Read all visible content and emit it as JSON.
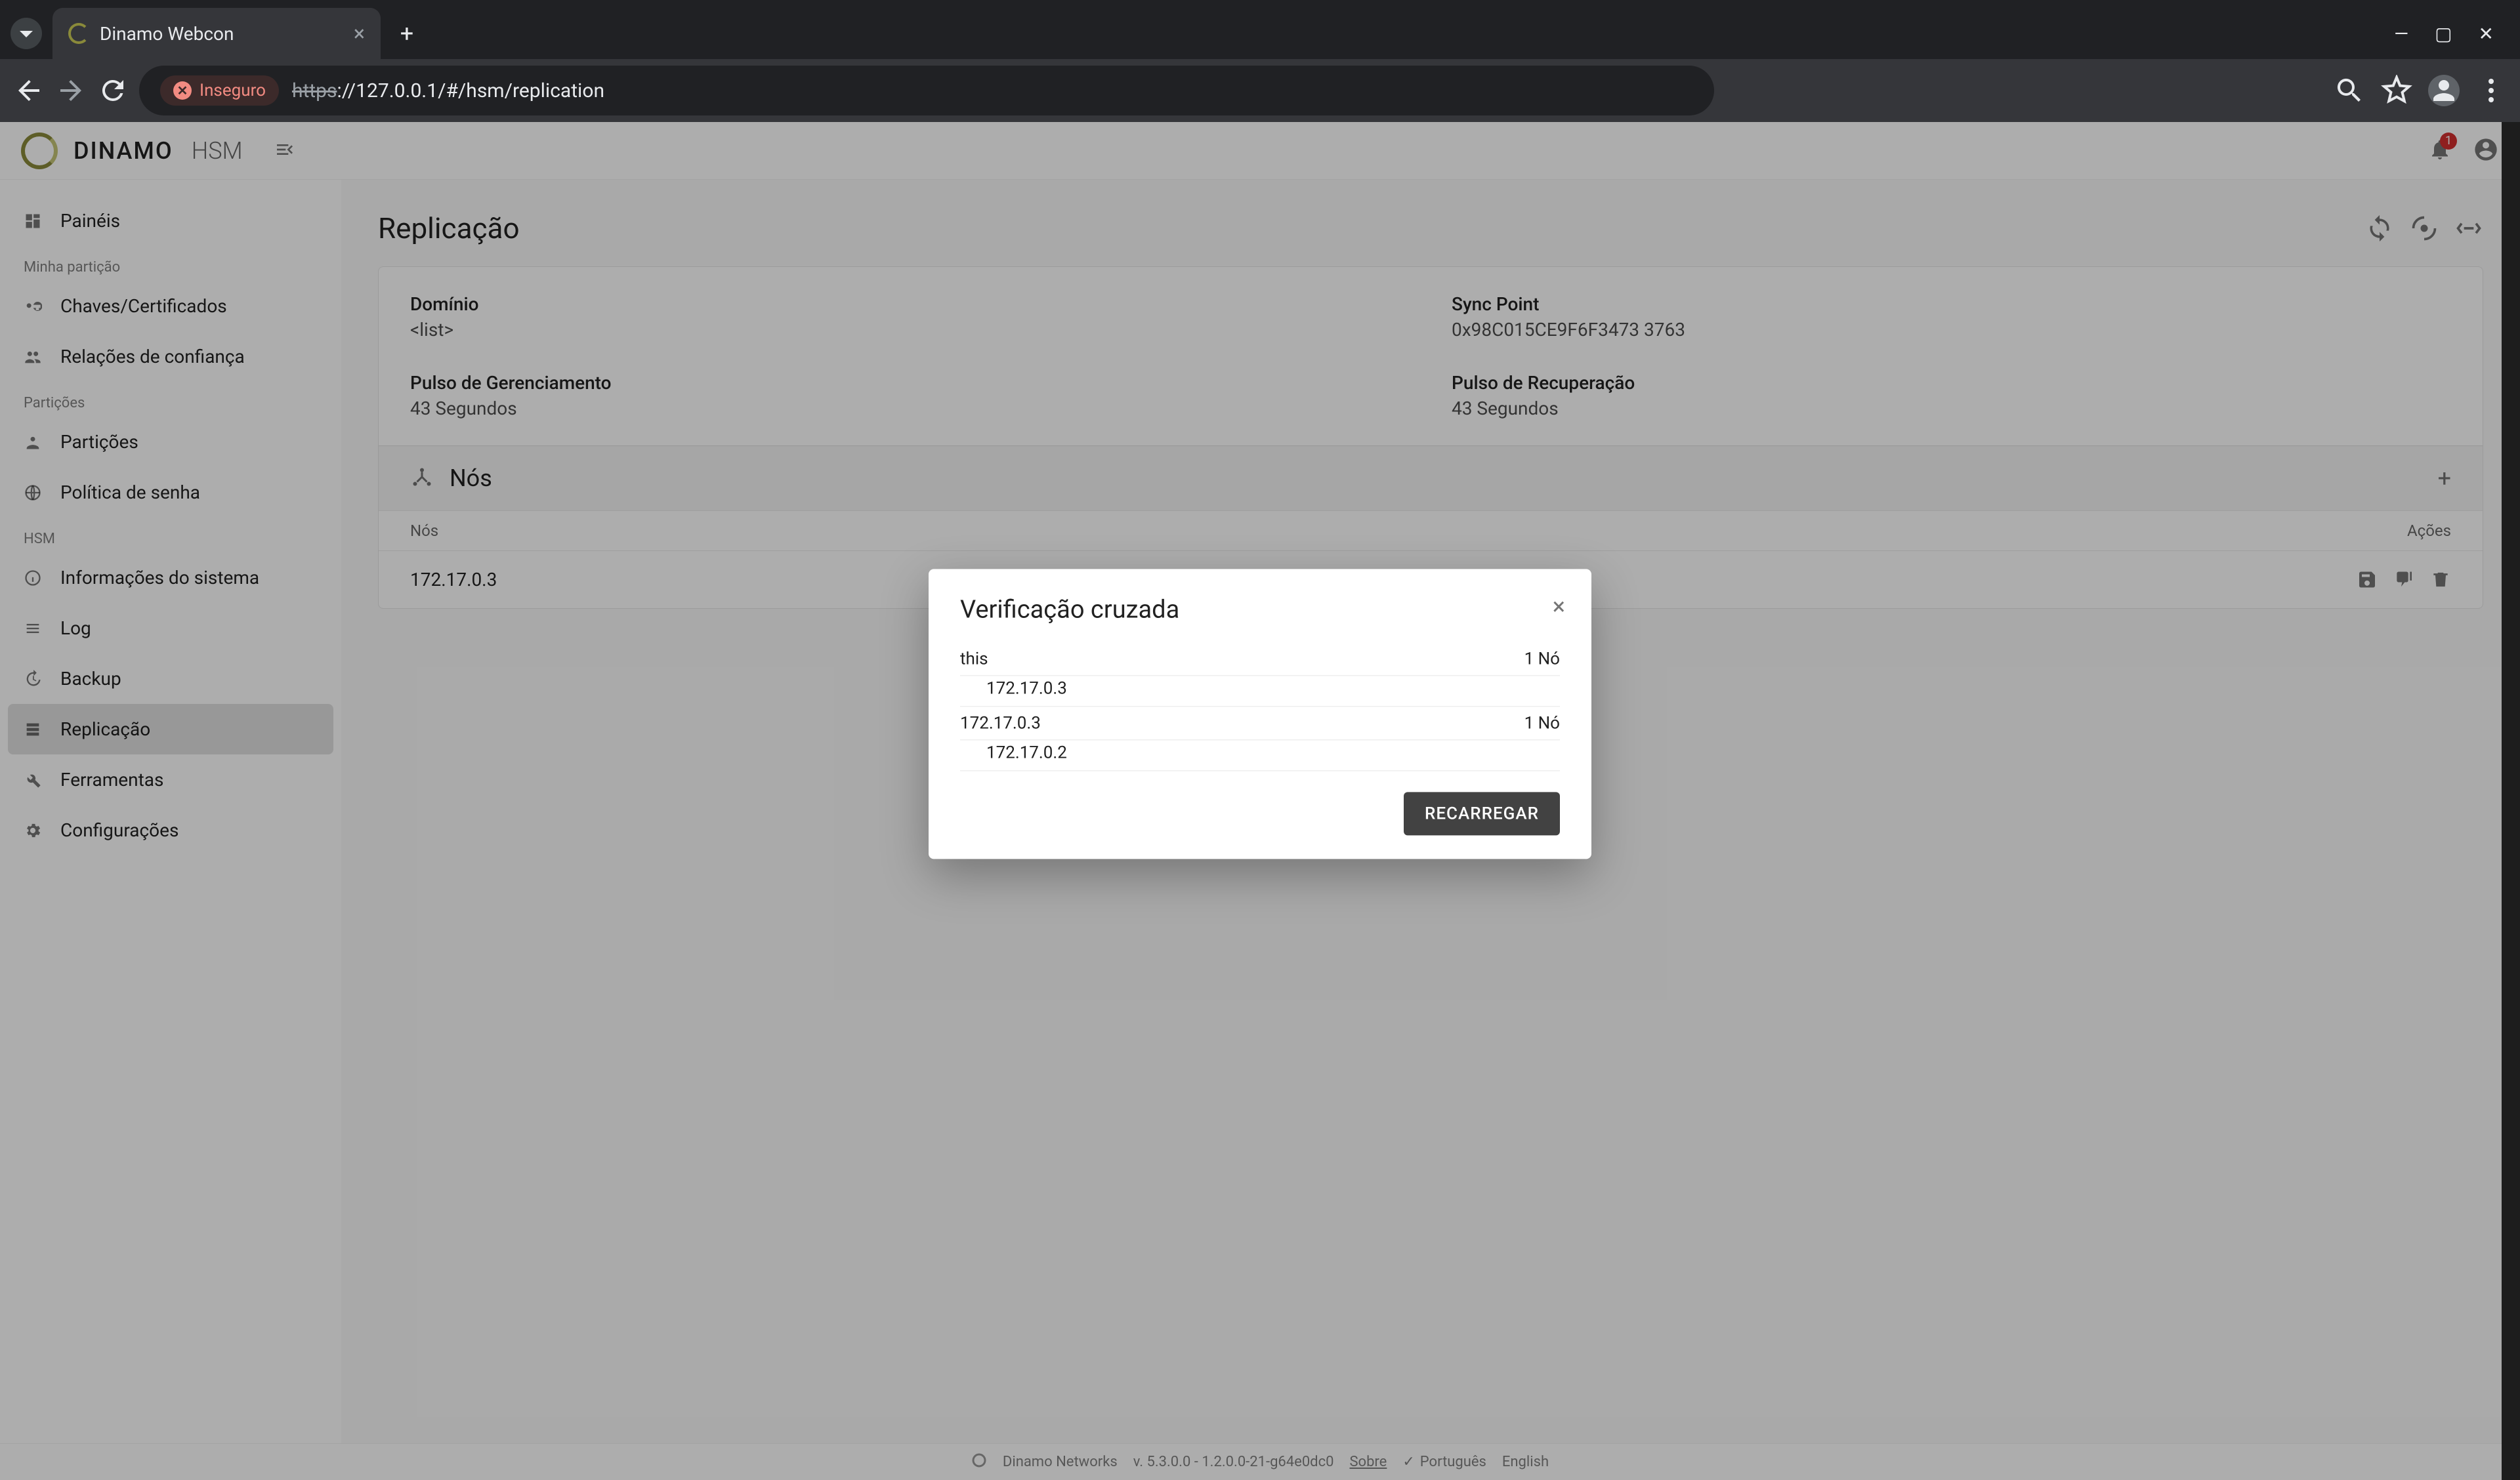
{
  "browser": {
    "tab_title": "Dinamo Webcon",
    "insecure_label": "Inseguro",
    "url_protocol": "https",
    "url_rest": "://127.0.0.1/#/hsm/replication"
  },
  "header": {
    "brand": "DINAMO",
    "brand_sub": "HSM",
    "notif_count": "1"
  },
  "sidebar": {
    "items": [
      {
        "label": "Painéis",
        "icon": "dashboard"
      },
      {
        "section": "Minha partição"
      },
      {
        "label": "Chaves/Certificados",
        "icon": "key"
      },
      {
        "label": "Relações de confiança",
        "icon": "users"
      },
      {
        "section": "Partições"
      },
      {
        "label": "Partições",
        "icon": "people"
      },
      {
        "label": "Política de senha",
        "icon": "globe"
      },
      {
        "section": "HSM"
      },
      {
        "label": "Informações do sistema",
        "icon": "info"
      },
      {
        "label": "Log",
        "icon": "list"
      },
      {
        "label": "Backup",
        "icon": "history"
      },
      {
        "label": "Replicação",
        "icon": "storage",
        "active": true
      },
      {
        "label": "Ferramentas",
        "icon": "tools"
      },
      {
        "label": "Configurações",
        "icon": "gear"
      }
    ]
  },
  "page": {
    "title": "Replicação",
    "info": {
      "domain_label": "Domínio",
      "domain_value": "<list>",
      "syncpoint_label": "Sync Point",
      "syncpoint_value": "0x98C015CE9F6F3473 3763",
      "mgmt_label": "Pulso de Gerenciamento",
      "mgmt_value": "43 Segundos",
      "recovery_label": "Pulso de Recuperação",
      "recovery_value": "43 Segundos"
    },
    "nodes": {
      "title": "Nós",
      "col_nodes": "Nós",
      "col_actions": "Ações",
      "rows": [
        {
          "ip": "172.17.0.3"
        }
      ]
    }
  },
  "modal": {
    "title": "Verificação cruzada",
    "entries": [
      {
        "host": "this",
        "count": "1 Nó",
        "sub": "172.17.0.3"
      },
      {
        "host": "172.17.0.3",
        "count": "1 Nó",
        "sub": "172.17.0.2"
      }
    ],
    "reload": "RECARREGAR"
  },
  "footer": {
    "company": "Dinamo Networks",
    "version": "v. 5.3.0.0 - 1.2.0.0-21-g64e0dc0",
    "about": "Sobre",
    "lang_pt": "Português",
    "lang_en": "English"
  }
}
